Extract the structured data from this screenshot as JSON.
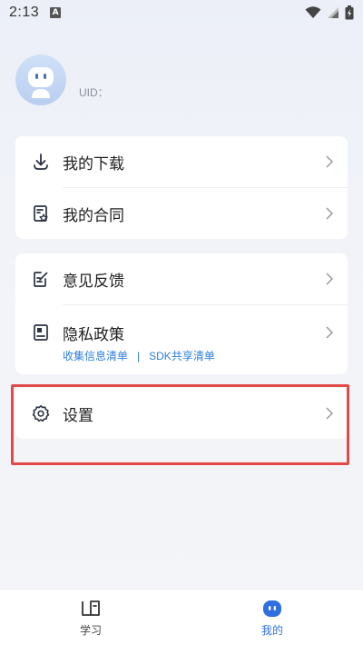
{
  "status_bar": {
    "time": "2:13",
    "notification_letter": "A"
  },
  "profile": {
    "uid_label": "UID："
  },
  "menu_group_1": [
    {
      "label": "我的下载",
      "icon": "download-icon"
    },
    {
      "label": "我的合同",
      "icon": "contract-icon"
    }
  ],
  "menu_group_2": {
    "feedback_label": "意见反馈",
    "privacy_label": "隐私政策",
    "privacy_links": {
      "collection_list": "收集信息清单",
      "separator": "|",
      "sdk_list": "SDK共享清单"
    }
  },
  "menu_group_3": {
    "settings_label": "设置"
  },
  "bottom_nav": {
    "items": [
      {
        "label": "学习",
        "icon": "study-book-icon",
        "active": false
      },
      {
        "label": "我的",
        "icon": "mine-robot-icon",
        "active": true
      }
    ]
  },
  "colors": {
    "accent": "#2f6fe0",
    "link": "#2f7fd8",
    "highlight": "#e24a4a",
    "icon_dark": "#2a3142"
  }
}
